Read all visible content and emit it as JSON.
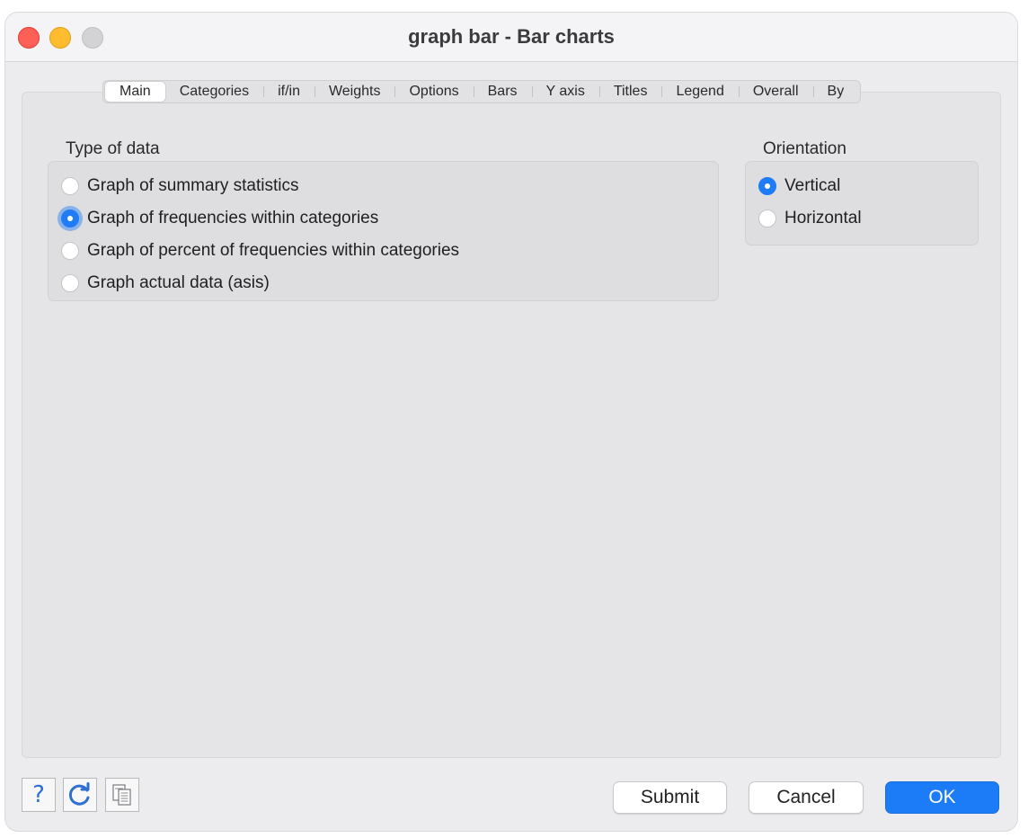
{
  "window": {
    "title": "graph bar - Bar charts"
  },
  "tabs": [
    {
      "label": "Main",
      "active": true
    },
    {
      "label": "Categories"
    },
    {
      "label": "if/in"
    },
    {
      "label": "Weights"
    },
    {
      "label": "Options"
    },
    {
      "label": "Bars"
    },
    {
      "label": "Y axis"
    },
    {
      "label": "Titles"
    },
    {
      "label": "Legend"
    },
    {
      "label": "Overall"
    },
    {
      "label": "By"
    }
  ],
  "type_of_data": {
    "label": "Type of data",
    "options": [
      {
        "label": "Graph of summary statistics",
        "checked": false
      },
      {
        "label": "Graph of frequencies within categories",
        "checked": true
      },
      {
        "label": "Graph of percent of frequencies within categories",
        "checked": false
      },
      {
        "label": "Graph actual data (asis)",
        "checked": false
      }
    ]
  },
  "orientation": {
    "label": "Orientation",
    "options": [
      {
        "label": "Vertical",
        "checked": true
      },
      {
        "label": "Horizontal",
        "checked": false
      }
    ]
  },
  "footer": {
    "help_icon": "help-icon",
    "reset_icon": "reset-icon",
    "copy_icon": "copy-command-icon",
    "submit_label": "Submit",
    "cancel_label": "Cancel",
    "ok_label": "OK"
  },
  "colors": {
    "accent": "#1c7cf7",
    "close": "#fe5f57",
    "minimize": "#febc2e"
  }
}
